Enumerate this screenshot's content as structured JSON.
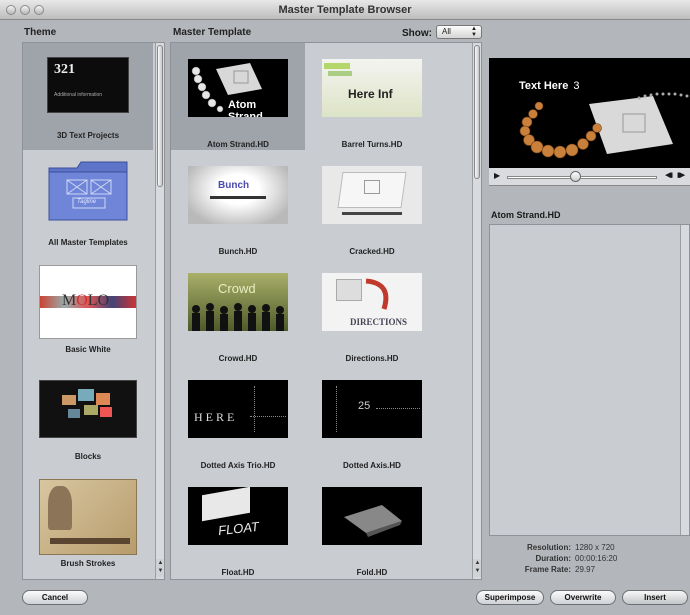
{
  "window": {
    "title": "Master Template Browser"
  },
  "theme": {
    "header": "Theme",
    "items": [
      {
        "label": "3D Text Projects",
        "selected": true,
        "thumb_text": [
          "321",
          "Additional information"
        ]
      },
      {
        "label": "All Master Templates",
        "selected": false,
        "thumb_text": [
          "Tagline"
        ]
      },
      {
        "label": "Basic White",
        "selected": false,
        "thumb_text": [
          "M",
          "O",
          "LO"
        ]
      },
      {
        "label": "Blocks",
        "selected": false,
        "thumb_text": []
      },
      {
        "label": "Brush Strokes",
        "selected": false,
        "thumb_text": []
      }
    ]
  },
  "master": {
    "header": "Master Template",
    "show_label": "Show:",
    "show_value": "All",
    "items": [
      {
        "label": "Atom Strand.HD",
        "selected": true,
        "thumb_text": "Atom Strand"
      },
      {
        "label": "Barrel Turns.HD",
        "selected": false,
        "thumb_text": "Here Inf"
      },
      {
        "label": "Bunch.HD",
        "selected": false,
        "thumb_text": "Bunch"
      },
      {
        "label": "Cracked.HD",
        "selected": false,
        "thumb_text": ""
      },
      {
        "label": "Crowd.HD",
        "selected": false,
        "thumb_text": "Crowd"
      },
      {
        "label": "Directions.HD",
        "selected": false,
        "thumb_text": "DIRECTIONS"
      },
      {
        "label": "Dotted Axis Trio.HD",
        "selected": false,
        "thumb_text": "HERE"
      },
      {
        "label": "Dotted Axis.HD",
        "selected": false,
        "thumb_text": "25"
      },
      {
        "label": "Float.HD",
        "selected": false,
        "thumb_text": "FLOAT"
      },
      {
        "label": "Fold.HD",
        "selected": false,
        "thumb_text": ""
      }
    ]
  },
  "preview": {
    "overlay_text": "Text Here",
    "overlay_num": "3",
    "selected_name": "Atom Strand.HD",
    "scrub_position": 0.45
  },
  "info": {
    "resolution_label": "Resolution:",
    "resolution_value": "1280 x 720",
    "duration_label": "Duration:",
    "duration_value": "00:00:16:20",
    "framerate_label": "Frame Rate:",
    "framerate_value": "29.97"
  },
  "buttons": {
    "cancel": "Cancel",
    "superimpose": "Superimpose",
    "overwrite": "Overwrite",
    "insert": "Insert"
  }
}
